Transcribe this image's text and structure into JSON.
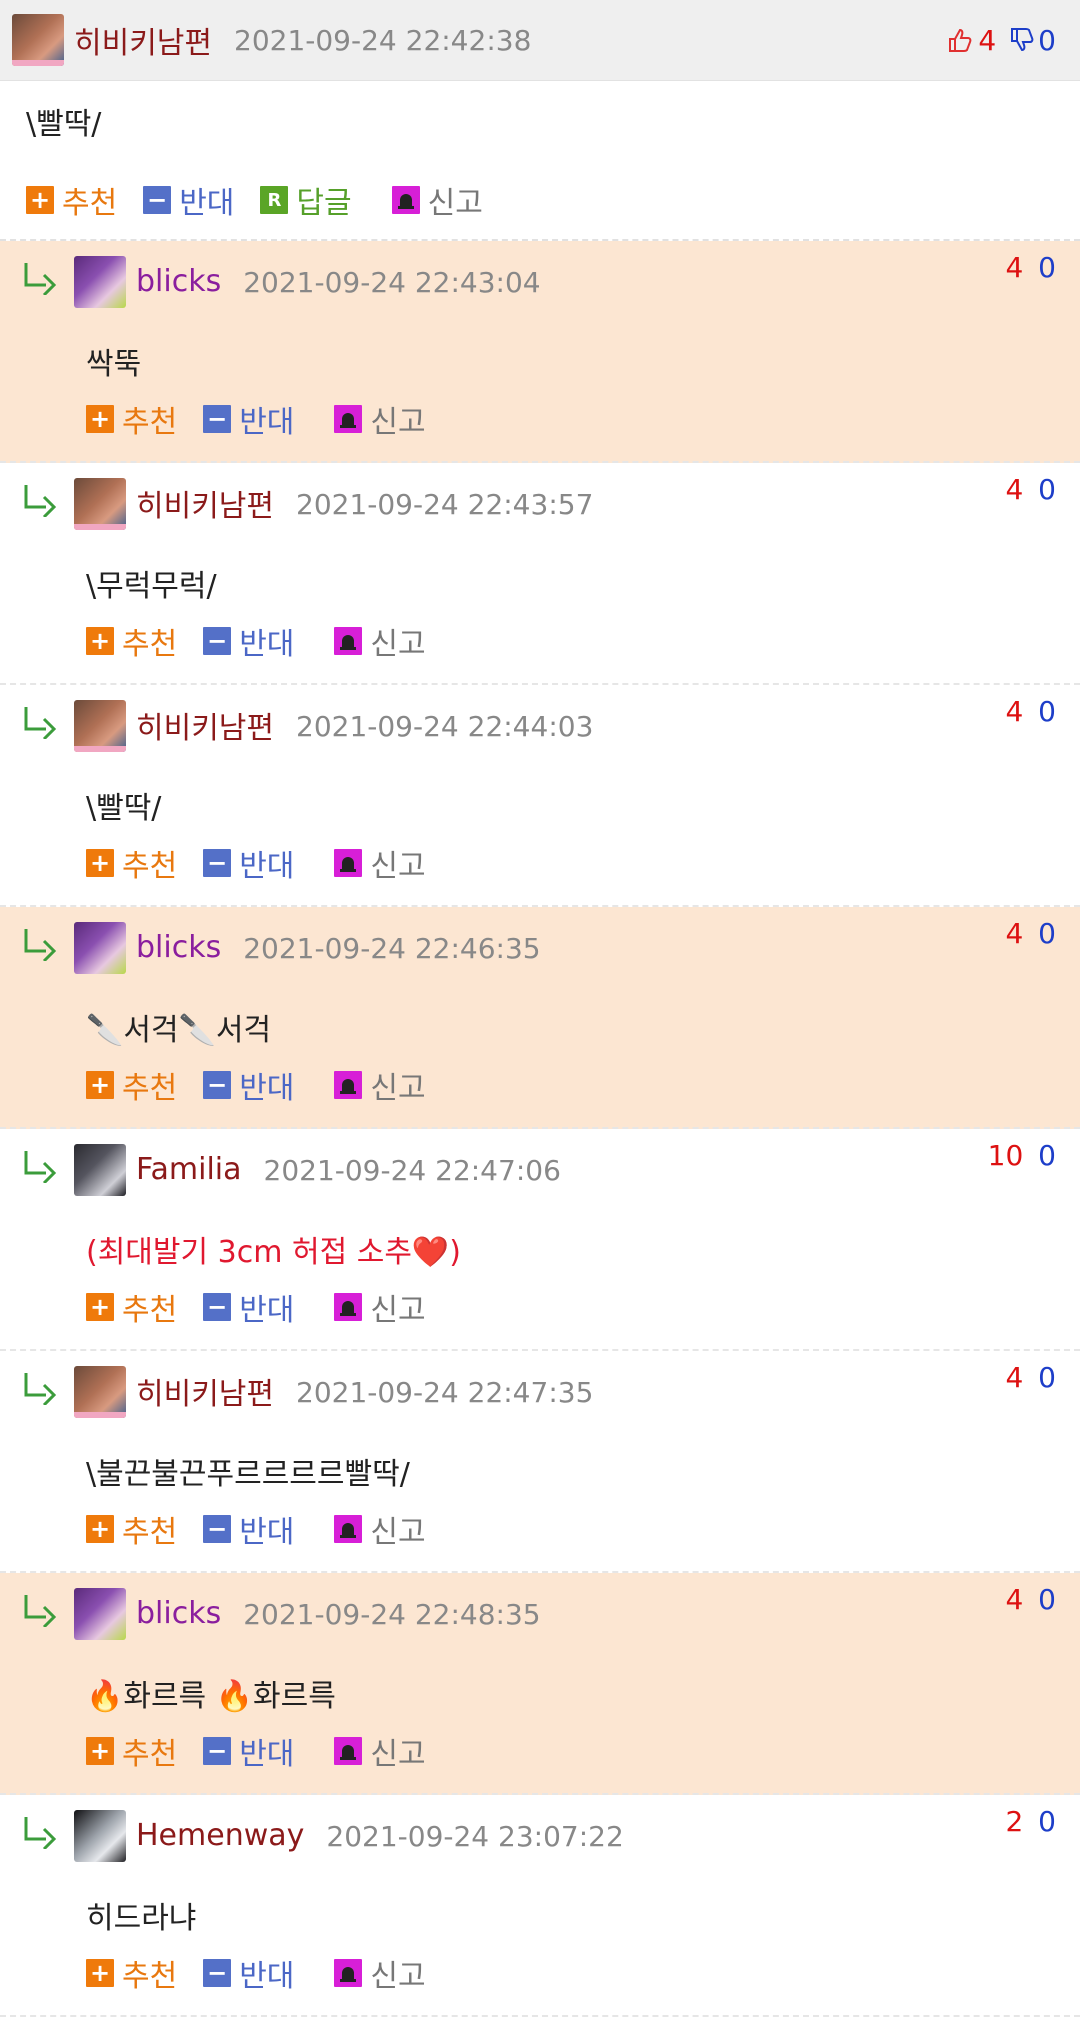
{
  "main": {
    "username": "히비키남편",
    "timestamp": "2021-09-24 22:42:38",
    "upvotes": "4",
    "downvotes": "0",
    "body": "\\빨딱/",
    "actions": {
      "recommend": "추천",
      "oppose": "반대",
      "reply": "답글",
      "report": "신고"
    },
    "username_color": "#8b1a1a"
  },
  "replies": [
    {
      "username": "blicks",
      "timestamp": "2021-09-24 22:43:04",
      "up": "4",
      "down": "0",
      "body": "싹뚝",
      "name_color": "#8a1e9e",
      "highlighted": true
    },
    {
      "username": "히비키남편",
      "timestamp": "2021-09-24 22:43:57",
      "up": "4",
      "down": "0",
      "body": "\\무럭무럭/",
      "name_color": "#8b1a1a",
      "highlighted": false
    },
    {
      "username": "히비키남편",
      "timestamp": "2021-09-24 22:44:03",
      "up": "4",
      "down": "0",
      "body": "\\빨딱/",
      "name_color": "#8b1a1a",
      "highlighted": false
    },
    {
      "username": "blicks",
      "timestamp": "2021-09-24 22:46:35",
      "up": "4",
      "down": "0",
      "body": "🔪서걱🔪서걱",
      "name_color": "#8a1e9e",
      "highlighted": true
    },
    {
      "username": "Familia",
      "timestamp": "2021-09-24 22:47:06",
      "up": "10",
      "down": "0",
      "body": "(최대발기 3cm 허접 소추❤️)",
      "name_color": "#8b1a1a",
      "highlighted": false,
      "red": true
    },
    {
      "username": "히비키남편",
      "timestamp": "2021-09-24 22:47:35",
      "up": "4",
      "down": "0",
      "body": "\\불끈불끈푸르르르르빨딱/",
      "name_color": "#8b1a1a",
      "highlighted": false
    },
    {
      "username": "blicks",
      "timestamp": "2021-09-24 22:48:35",
      "up": "4",
      "down": "0",
      "body": "🔥화르륵 🔥화르륵",
      "name_color": "#8a1e9e",
      "highlighted": true
    },
    {
      "username": "Hemenway",
      "timestamp": "2021-09-24 23:07:22",
      "up": "2",
      "down": "0",
      "body": "히드라냐",
      "name_color": "#8b1a1a",
      "highlighted": false
    }
  ],
  "reply_actions": {
    "recommend": "추천",
    "oppose": "반대",
    "report": "신고"
  },
  "colors": {
    "highlight_bg": "#fce6d2",
    "up": "#dd1111",
    "down": "#1d3ec9"
  }
}
